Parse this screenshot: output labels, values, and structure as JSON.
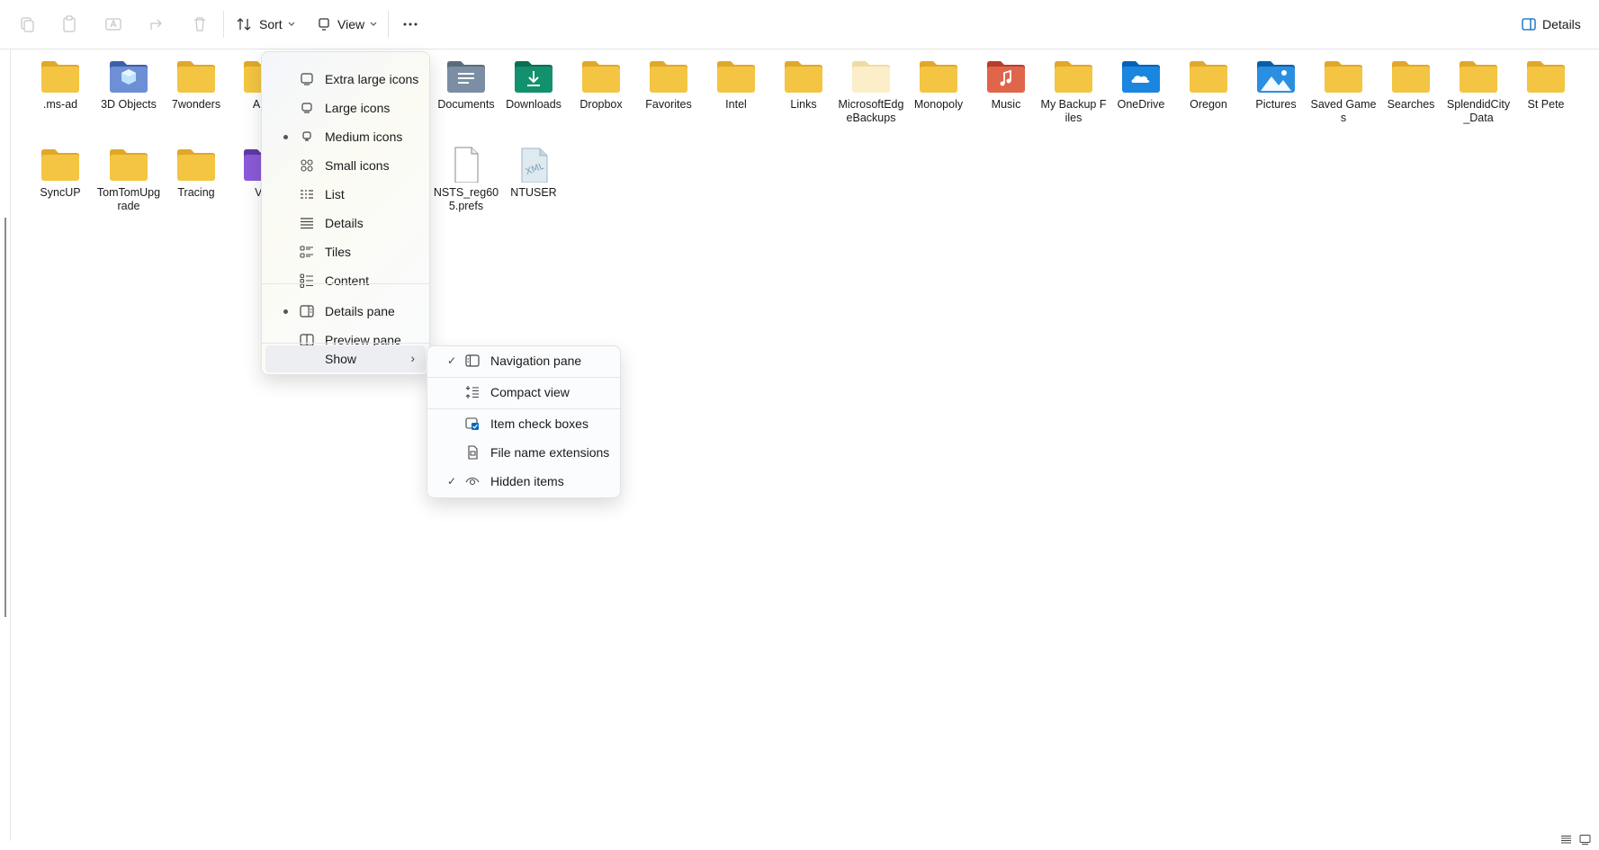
{
  "toolbar": {
    "sort_label": "Sort",
    "view_label": "View",
    "details_label": "Details"
  },
  "items": [
    {
      "label": ".ms-ad",
      "icon": "folder-icon"
    },
    {
      "label": "3D Objects",
      "icon": "3d-objects-icon"
    },
    {
      "label": "7wonders",
      "icon": "folder-icon"
    },
    {
      "label": "App",
      "icon": "folder-icon"
    },
    {
      "label": "Documents",
      "icon": "documents-folder-icon"
    },
    {
      "label": "Downloads",
      "icon": "downloads-folder-icon"
    },
    {
      "label": "Dropbox",
      "icon": "folder-icon"
    },
    {
      "label": "Favorites",
      "icon": "folder-icon"
    },
    {
      "label": "Intel",
      "icon": "folder-icon"
    },
    {
      "label": "Links",
      "icon": "folder-icon"
    },
    {
      "label": "MicrosoftEdgeBackups",
      "icon": "folder-light-icon"
    },
    {
      "label": "Monopoly",
      "icon": "folder-icon"
    },
    {
      "label": "Music",
      "icon": "music-folder-icon"
    },
    {
      "label": "My Backup Files",
      "icon": "folder-icon"
    },
    {
      "label": "OneDrive",
      "icon": "onedrive-folder-icon"
    },
    {
      "label": "Oregon",
      "icon": "folder-icon"
    },
    {
      "label": "Pictures",
      "icon": "pictures-folder-icon"
    },
    {
      "label": "Saved Games",
      "icon": "folder-icon"
    },
    {
      "label": "Searches",
      "icon": "folder-icon"
    },
    {
      "label": "SplendidCity_Data",
      "icon": "folder-icon"
    },
    {
      "label": "St Pete",
      "icon": "folder-icon"
    },
    {
      "label": "SyncUP",
      "icon": "folder-icon"
    },
    {
      "label": "TomTomUpgrade",
      "icon": "folder-icon"
    },
    {
      "label": "Tracing",
      "icon": "folder-icon"
    },
    {
      "label": "Vid",
      "icon": "videos-folder-icon"
    },
    {
      "label": "NSTS_reg605.prefs",
      "icon": "file-icon"
    },
    {
      "label": "NTUSER",
      "icon": "xml-file-icon"
    }
  ],
  "view_menu": {
    "items": [
      {
        "label": "Extra large icons",
        "selected": false
      },
      {
        "label": "Large icons",
        "selected": false
      },
      {
        "label": "Medium icons",
        "selected": true
      },
      {
        "label": "Small icons",
        "selected": false
      },
      {
        "label": "List",
        "selected": false
      },
      {
        "label": "Details",
        "selected": false
      },
      {
        "label": "Tiles",
        "selected": false
      },
      {
        "label": "Content",
        "selected": false
      }
    ],
    "panes": [
      {
        "label": "Details pane",
        "selected": true
      },
      {
        "label": "Preview pane",
        "selected": false
      }
    ],
    "show_label": "Show"
  },
  "show_menu": {
    "items": [
      {
        "label": "Navigation pane",
        "checked": true
      },
      {
        "label": "Compact view",
        "checked": false
      },
      {
        "label": "Item check boxes",
        "checked": false
      },
      {
        "label": "File name extensions",
        "checked": false
      },
      {
        "label": "Hidden items",
        "checked": true
      }
    ]
  },
  "colors": {
    "folder": "#f4c542",
    "folder_dark": "#e0a82a",
    "accent": "#0067c0"
  }
}
